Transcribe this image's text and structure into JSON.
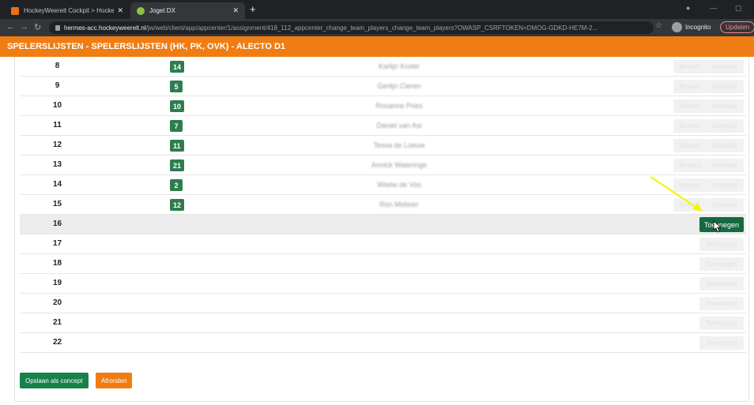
{
  "browser": {
    "tabs": [
      {
        "title": "HockeyWeerelt Cockpit > Hocke",
        "active": false
      },
      {
        "title": "Joget DX",
        "active": true
      }
    ],
    "new_tab": "+",
    "url_host": "hermes-acc.hockeyweerelt.nl",
    "url_path": "/jw/web/client/app/appcenter/1/assignment/418_112_appcenter_change_team_players_change_team_players?OWASP_CSRFTOKEN=DMOG-GDKD-HE7M-2...",
    "incognito_label": "Incognito",
    "update_label": "Updaten"
  },
  "header": {
    "title": "SPELERSLIJSTEN - SPELERSLIJSTEN (HK, PK, OVK) - ALECTO D1"
  },
  "table": {
    "edit_label": "Bewerk",
    "delete_label": "Verwijder",
    "add_label": "Toevoegen",
    "rows": [
      {
        "num": "8",
        "shirt": "14",
        "name": "Karlijn Kroter"
      },
      {
        "num": "9",
        "shirt": "5",
        "name": "Gerlijn Cieren"
      },
      {
        "num": "10",
        "shirt": "10",
        "name": "Rosanne Pries"
      },
      {
        "num": "11",
        "shirt": "7",
        "name": "Daniel van Asi"
      },
      {
        "num": "12",
        "shirt": "11",
        "name": "Tessa de Loeuw"
      },
      {
        "num": "13",
        "shirt": "21",
        "name": "Annick Wateringe"
      },
      {
        "num": "14",
        "shirt": "2",
        "name": "Wiebe de Vos"
      },
      {
        "num": "15",
        "shirt": "12",
        "name": "Ron Meboer"
      },
      {
        "num": "16",
        "shirt": "",
        "name": ""
      },
      {
        "num": "17",
        "shirt": "",
        "name": ""
      },
      {
        "num": "18",
        "shirt": "",
        "name": ""
      },
      {
        "num": "19",
        "shirt": "",
        "name": ""
      },
      {
        "num": "20",
        "shirt": "",
        "name": ""
      },
      {
        "num": "21",
        "shirt": "",
        "name": ""
      },
      {
        "num": "22",
        "shirt": "",
        "name": ""
      }
    ]
  },
  "footer": {
    "save_label": "Opslaan als concept",
    "finish_label": "Afronden"
  },
  "colors": {
    "header": "#f07d13",
    "badge": "#2e7d4f",
    "add_button": "#17693f",
    "save_button": "#17814a",
    "annotation_arrow": "#f5f500"
  },
  "icons": [
    "lock-icon",
    "star-icon",
    "incognito-icon",
    "back-icon",
    "forward-icon",
    "reload-icon",
    "cursor-hand-icon",
    "arrow-annotation-icon"
  ]
}
